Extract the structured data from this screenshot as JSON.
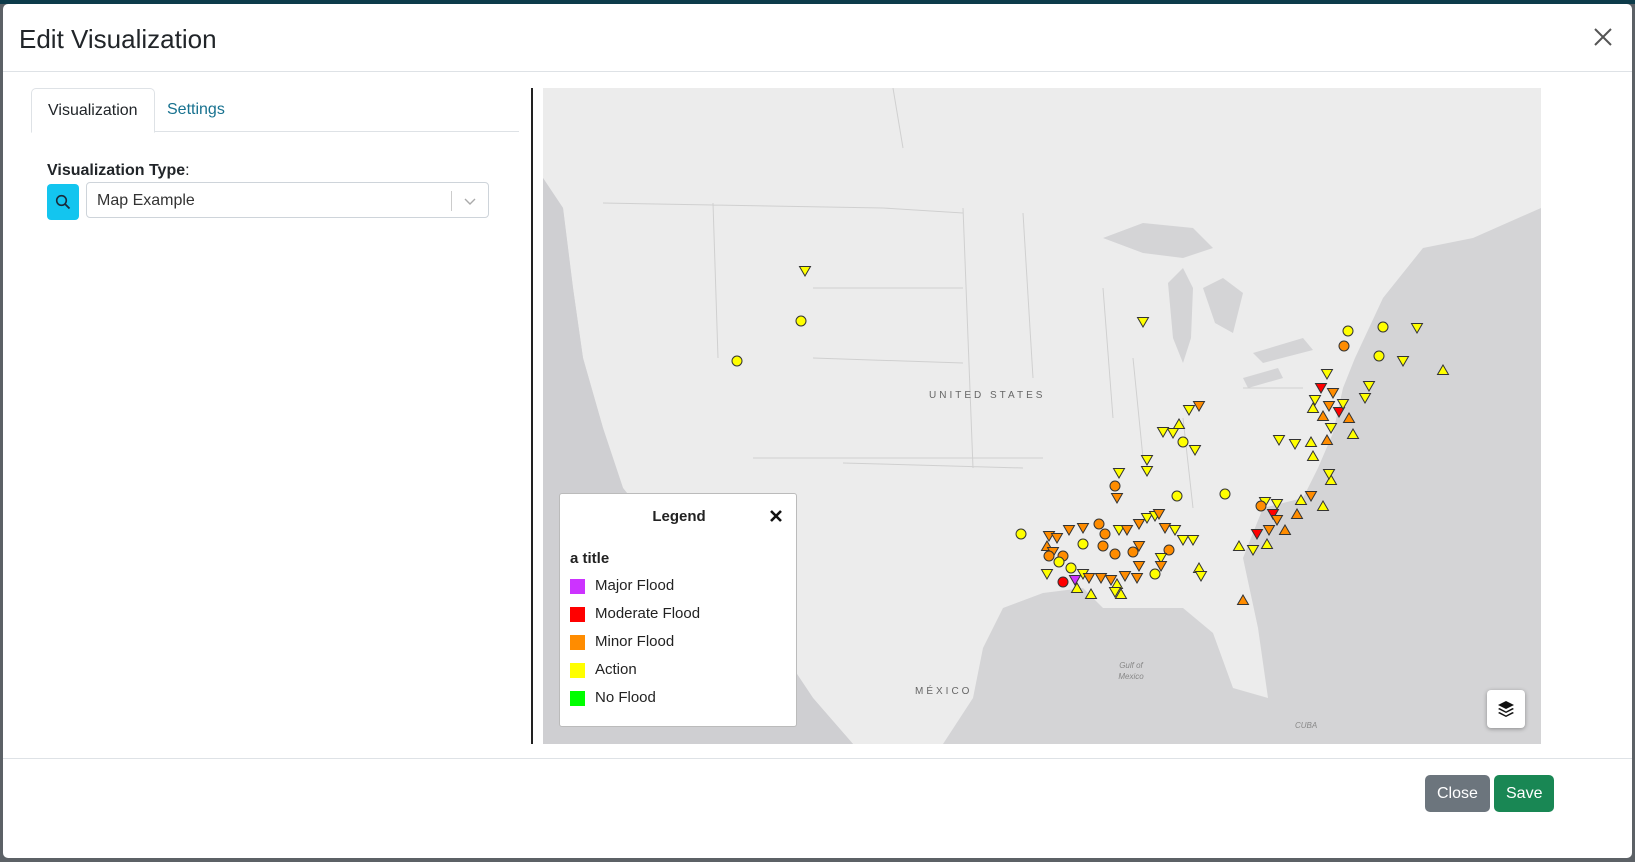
{
  "modal": {
    "title": "Edit Visualization"
  },
  "tabs": [
    {
      "label": "Visualization",
      "active": true
    },
    {
      "label": "Settings",
      "active": false
    }
  ],
  "form": {
    "label": "Visualization Type",
    "label_suffix": ":",
    "selected": "Map Example"
  },
  "map": {
    "country_label": "UNITED STATES",
    "mexico_label": "MÉXICO",
    "gulf_label": "Gulf of Mexico",
    "cuba_label": "CUBA"
  },
  "legend": {
    "title": "Legend",
    "subtitle": "a title",
    "items": [
      {
        "label": "Major Flood",
        "color": "#cc33ff"
      },
      {
        "label": "Moderate Flood",
        "color": "#ff0000"
      },
      {
        "label": "Minor Flood",
        "color": "#ff8c00"
      },
      {
        "label": "Action",
        "color": "#ffff00"
      },
      {
        "label": "No Flood",
        "color": "#00ff00"
      }
    ]
  },
  "footer": {
    "close_label": "Close",
    "save_label": "Save"
  },
  "icons": {
    "close": "close-icon",
    "search": "search-icon",
    "dropdown": "chevron-down-icon",
    "layers": "layers-icon"
  }
}
